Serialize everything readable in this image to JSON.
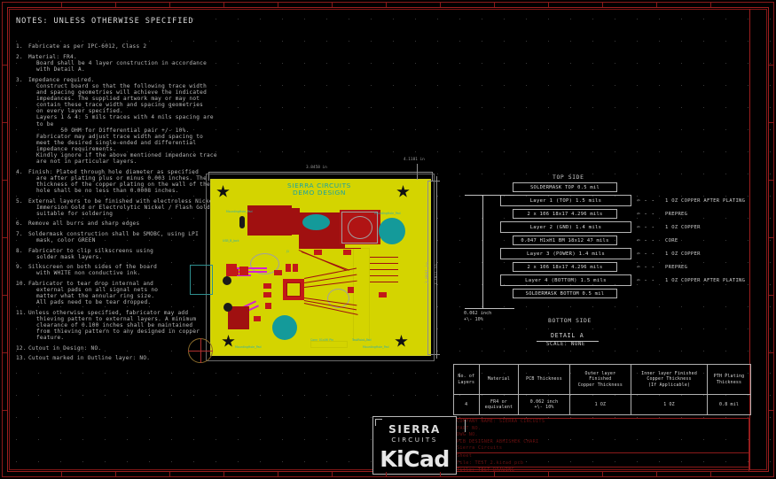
{
  "notes": {
    "title": "NOTES: UNLESS OTHERWISE SPECIFIED",
    "items": [
      {
        "num": "1.",
        "text": "Fabricate as per IPC-6012, Class 2"
      },
      {
        "num": "2.",
        "text": "Material: FR4.",
        "sub": "Board shall be 4 layer construction in accordance\nwith Detail A."
      },
      {
        "num": "3.",
        "text": "Impedance required.",
        "sub": "Construct board so that the following trace width\nand spacing geometries will achieve the indicated\nimpedances. The supplied artwork may or may not\ncontain these trace width and spacing geometries\non every layer specified.\nLayers 1 & 4: 5 mils traces with 4 mils spacing are to be\n       50 OHM for Differential pair +/- 10%.\nFabricator may adjust trace width and spacing to\nmeet the desired single-ended and differential\nimpedance requirements.\nKindly ignore if the above mentioned impedance trace\nare not in particular layers."
      },
      {
        "num": "4.",
        "text": "Finish: Plated through hole diameter as specified",
        "sub": "are after plating plus or minus 0.003 inches. The\nthickness of the copper plating on the wall of the\nhole shall be no less than 0.0008 inches."
      },
      {
        "num": "5.",
        "text": "External layers to be finished with electroless Nickel/",
        "sub": "Immersion Gold or Electrolytic Nickel / Flash Gold\nsuitable for soldering"
      },
      {
        "num": "6.",
        "text": "Remove all burrs and sharp edges"
      },
      {
        "num": "7.",
        "text": "Soldermask construction shall be SMOBC, using LPI",
        "sub": "mask, color GREEN"
      },
      {
        "num": "8.",
        "text": "Fabricator to clip silkscreens using",
        "sub": "solder mask layers."
      },
      {
        "num": "9.",
        "text": "Silkscreen on both sides of the board",
        "sub": "with WHITE non conductive ink."
      },
      {
        "num": "10.",
        "text": "Fabricator to tear drop internal and",
        "sub": "external pads on all signal nets no\nmatter what the annular ring size.\nAll pads need to be tear dropped."
      },
      {
        "num": "11.",
        "text": "Unless otherwise specified, fabricator may add",
        "sub": "thieving pattern to external layers. A minimum\nclearance of 0.100 inches shall be maintained\nfrom thieving pattern to any designed in copper\nfeature."
      },
      {
        "num": "12.",
        "text": "Cutout in Design: NO."
      },
      {
        "num": "13.",
        "text": "Cutout marked in Outline layer: NO."
      }
    ]
  },
  "board": {
    "silkscreen_title_line1": "SIERRA CIRCUITS",
    "silkscreen_title_line2": "DEMO DESIGN",
    "dimensions": {
      "width": "3.8458 in",
      "height_outer": "3.1811 in",
      "height_inner": "2.9881 in",
      "corner": "4.1181 in"
    }
  },
  "stackup": {
    "top_side_label": "TOP SIDE",
    "bottom_side_label": "BOTTOM SIDE",
    "detail_label": "DETAIL A",
    "scale_label": "SCALE: NONE",
    "total_thickness_line1": "0.062 inch",
    "total_thickness_line2": "+\\- 10%",
    "rows": [
      {
        "label": "SOLDERMASK TOP   0.5 mil",
        "wide": false,
        "note": ""
      },
      {
        "label": "Layer 1 (TOP)  1.5 mils",
        "wide": true,
        "note": "1 OZ COPPER AFTER PLATING"
      },
      {
        "label": "2 x 106 18x17      4.296 mils",
        "wide": false,
        "note": "PREPREG"
      },
      {
        "label": "Layer 2 (GND)  1.4 mils",
        "wide": true,
        "note": "1 OZ COPPER"
      },
      {
        "label": "0.047 H1xH1 BM 18x12 47 mils",
        "wide": false,
        "note": "CORE"
      },
      {
        "label": "Layer 3 (POWER) 1.4 mils",
        "wide": true,
        "note": "1 OZ COPPER"
      },
      {
        "label": "2 x 106 18x17      4.296 mils",
        "wide": false,
        "note": "PREPREG"
      },
      {
        "label": "Layer 4 (BOTTOM) 1.5 mils",
        "wide": true,
        "note": "1 OZ COPPER AFTER PLATING"
      },
      {
        "label": "SOLDERMASK BOTTOM  0.5 mil",
        "wide": false,
        "note": ""
      }
    ],
    "arrow_glyph": "⇦ - -"
  },
  "spec_table": {
    "headers": [
      "No. of\nLayers",
      "Material",
      "PCB Thickness",
      "Outer layer\nFinished\nCopper Thickness",
      "Inner layer Finished\nCopper Thickness\n(If Applicable)",
      "PTH Plating\nThickness"
    ],
    "row": [
      "4",
      "FR4 or\nequivalent",
      "0.062 inch\n+\\- 10%",
      "1 OZ",
      "1 OZ",
      "0.8 mil"
    ]
  },
  "titleblock": {
    "company": "COMPANY NAME: SIERRA CIRCUITS",
    "part_no": "PART NO.",
    "dwg_no": "DWG NO.",
    "designer": "PCB DESIGNER ABHISHEK CHARI",
    "org": "Sierra Circuits",
    "sheet": "Sheet",
    "file": "File: TEST_2.kicad_pcb",
    "footer": "Title: TEST DRAWING"
  },
  "logo": {
    "sierra": "SIERRA",
    "circuits": "CIRCUITS",
    "kicad": "KiCad"
  }
}
